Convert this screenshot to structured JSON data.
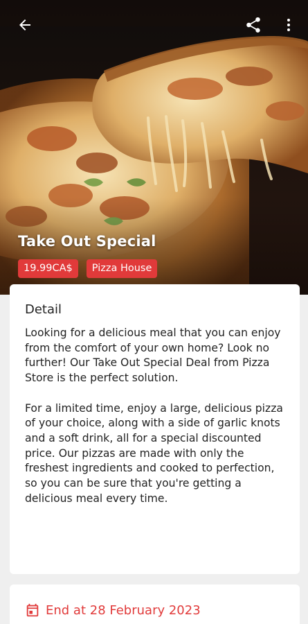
{
  "header": {
    "icons": {
      "back": "arrow-left-icon",
      "share": "share-icon",
      "more": "more-vertical-icon"
    }
  },
  "offer": {
    "title": "Take Out Special",
    "price": "19.99CA$",
    "store": "Pizza House",
    "image": "pizza-photo"
  },
  "detail": {
    "heading": "Detail",
    "paragraphs": [
      "Looking for a delicious meal that you can enjoy from the comfort of your own home? Look no further! Our Take Out Special Deal from Pizza Store is the perfect solution.",
      "For a limited time, enjoy a large, delicious pizza of your choice, along with a side of garlic knots and a soft drink, all for a special discounted price. Our pizzas are made with only the freshest ingredients and cooked to perfection, so you can be sure that you're getting a delicious meal every time."
    ]
  },
  "end": {
    "icon": "calendar-icon",
    "label": "End at 28 February 2023"
  },
  "colors": {
    "accent": "#e13a3a",
    "card": "#ffffff",
    "background": "#efefef"
  }
}
